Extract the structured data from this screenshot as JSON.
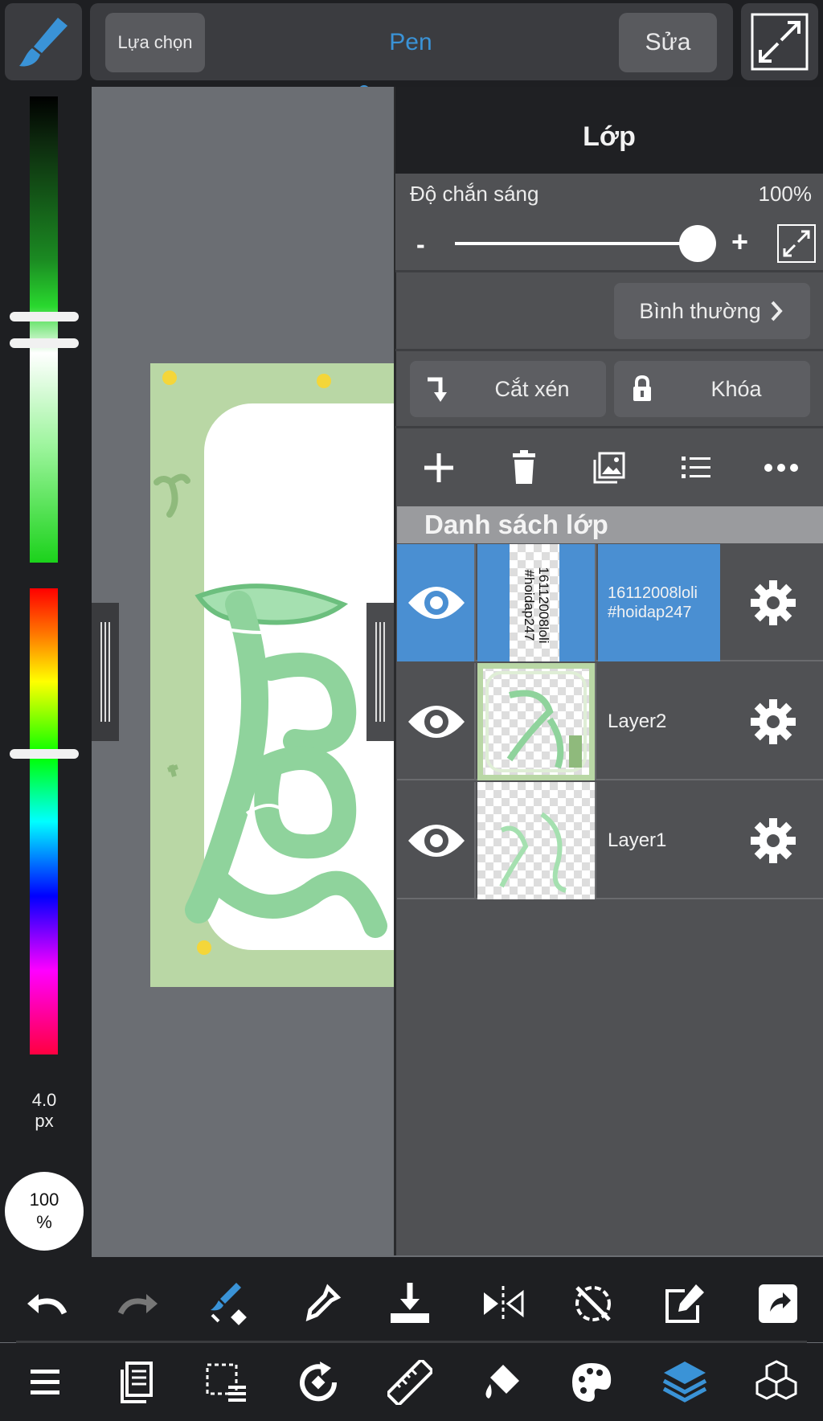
{
  "topbar": {
    "select_label": "Lựa chọn",
    "tool_name": "Pen",
    "edit_label": "Sửa",
    "brush_icon": "brush-icon",
    "expand_icon": "expand-icon"
  },
  "color_panel": {
    "brush_size": "4.0",
    "brush_unit": "px",
    "opacity_value": "100",
    "opacity_unit": "%",
    "brightness_level": 0.47,
    "hue_level": 0.32
  },
  "layer_panel": {
    "title": "Lớp",
    "opacity_label": "Độ chắn sáng",
    "opacity_value": "100%",
    "opacity_level": 1.0,
    "minus": "-",
    "plus": "+",
    "blend_mode": "Bình thường",
    "clip_label": "Cắt xén",
    "lock_label": "Khóa",
    "list_header": "Danh sách lớp",
    "tools": [
      "add-layer-icon",
      "delete-layer-icon",
      "image-layer-icon",
      "layer-list-icon",
      "more-icon"
    ],
    "layers": [
      {
        "name_line1": "16112008loli",
        "name_line2": "#hoidap247",
        "thumb_text": "16112008loli #hoidap247",
        "selected": true,
        "visible": true
      },
      {
        "name_line1": "Layer2",
        "name_line2": "",
        "thumb_text": "",
        "selected": false,
        "visible": true
      },
      {
        "name_line1": "Layer1",
        "name_line2": "",
        "thumb_text": "",
        "selected": false,
        "visible": true
      }
    ]
  },
  "colors": {
    "accent": "#3a93d7",
    "selected_row": "#4a8fd2",
    "panel_bg": "#505154",
    "toolbar_bg": "#1e1f22"
  },
  "bottom_toolbar_row1": [
    "undo-icon",
    "redo-icon",
    "brush-transform-icon",
    "eyedropper-icon",
    "save-icon",
    "flip-icon",
    "rotate-reset-icon",
    "edit-export-icon",
    "share-icon"
  ],
  "bottom_toolbar_row2": [
    "menu-icon",
    "pages-icon",
    "selection-icon",
    "rotate-icon",
    "ruler-icon",
    "fill-icon",
    "palette-icon",
    "layers-icon",
    "materials-icon"
  ]
}
